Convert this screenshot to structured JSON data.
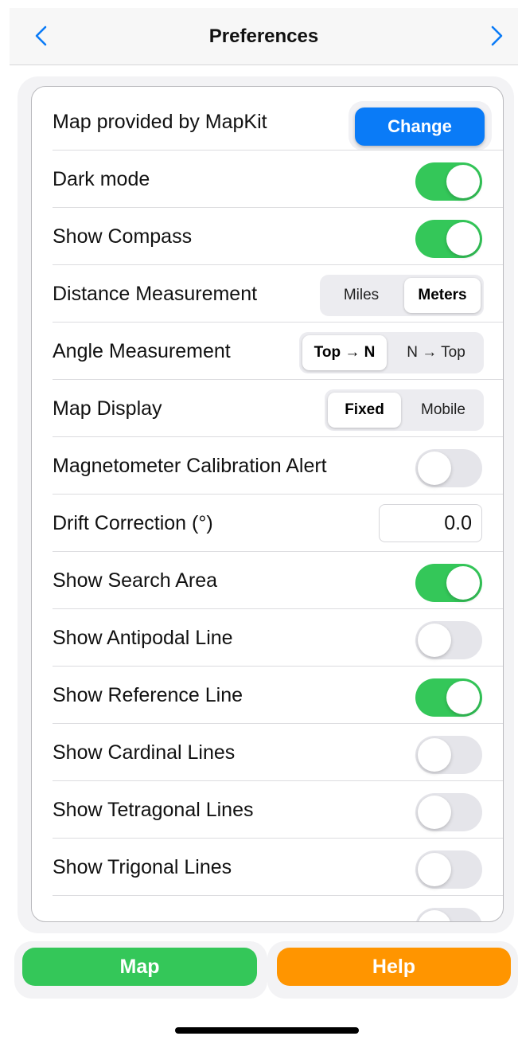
{
  "navbar": {
    "title": "Preferences",
    "back_icon": "chevron-left-icon",
    "forward_icon": "chevron-right-icon",
    "accent": "#0a7bf7"
  },
  "settings": {
    "map_provider": {
      "label": "Map provided by MapKit",
      "button": "Change"
    },
    "dark_mode": {
      "label": "Dark mode",
      "on": true
    },
    "show_compass": {
      "label": "Show Compass",
      "on": true
    },
    "distance": {
      "label": "Distance Measurement",
      "options": [
        "Miles",
        "Meters"
      ],
      "selected": "Meters"
    },
    "angle": {
      "label": "Angle Measurement",
      "options": [
        "Top → N",
        "N → Top"
      ],
      "selected": "Top → N"
    },
    "map_display": {
      "label": "Map Display",
      "options": [
        "Fixed",
        "Mobile"
      ],
      "selected": "Fixed"
    },
    "magnetometer": {
      "label": "Magnetometer Calibration Alert",
      "on": false
    },
    "drift": {
      "label": "Drift Correction (°)",
      "value": "0.0"
    },
    "search_area": {
      "label": "Show Search Area",
      "on": true
    },
    "antipodal": {
      "label": "Show Antipodal Line",
      "on": false
    },
    "reference": {
      "label": "Show Reference Line",
      "on": true
    },
    "cardinal": {
      "label": "Show Cardinal Lines",
      "on": false
    },
    "tetragonal": {
      "label": "Show Tetragonal Lines",
      "on": false
    },
    "trigonal": {
      "label": "Show Trigonal Lines",
      "on": false
    }
  },
  "bottom": {
    "map_label": "Map",
    "help_label": "Help",
    "map_color": "#34c759",
    "help_color": "#ff9500"
  }
}
